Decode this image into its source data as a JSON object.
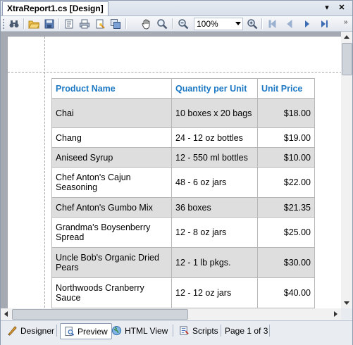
{
  "window": {
    "tab_title": "XtraReport1.cs [Design]",
    "tab_menu_glyph": "▾",
    "close_glyph": "✕"
  },
  "toolbar": {
    "zoom_value": "100%",
    "overflow_glyph": "»",
    "icons": [
      "find-icon",
      "open-icon",
      "save-icon",
      "page-setup-icon",
      "print-icon",
      "quick-print-icon",
      "export-icon",
      "hand-tool-icon",
      "magnifier-icon",
      "zoom-out-icon",
      "zoom-in-icon",
      "first-page-icon",
      "previous-page-icon",
      "next-page-icon",
      "last-page-icon"
    ]
  },
  "report": {
    "header_color": "#1c78c4",
    "alt_row_color": "#dedede",
    "columns": [
      "Product Name",
      "Quantity per Unit",
      "Unit Price"
    ],
    "rows": [
      {
        "name": "Chai",
        "qty": "10 boxes x 20 bags",
        "price": "$18.00"
      },
      {
        "name": "Chang",
        "qty": "24 - 12 oz bottles",
        "price": "$19.00"
      },
      {
        "name": "Aniseed Syrup",
        "qty": "12 - 550 ml bottles",
        "price": "$10.00"
      },
      {
        "name": "Chef Anton's Cajun Seasoning",
        "qty": "48 - 6 oz jars",
        "price": "$22.00"
      },
      {
        "name": "Chef Anton's Gumbo Mix",
        "qty": "36 boxes",
        "price": "$21.35"
      },
      {
        "name": "Grandma's Boysenberry Spread",
        "qty": "12 - 8 oz jars",
        "price": "$25.00"
      },
      {
        "name": "Uncle Bob's Organic Dried Pears",
        "qty": "12 - 1 lb pkgs.",
        "price": "$30.00"
      },
      {
        "name": "Northwoods Cranberry Sauce",
        "qty": "12 - 12 oz jars",
        "price": "$40.00"
      }
    ]
  },
  "view_tabs": {
    "designer": "Designer",
    "preview": "Preview",
    "html_view": "HTML View",
    "scripts": "Scripts",
    "active": "Preview"
  },
  "status": {
    "page_info": "Page 1 of 3"
  }
}
